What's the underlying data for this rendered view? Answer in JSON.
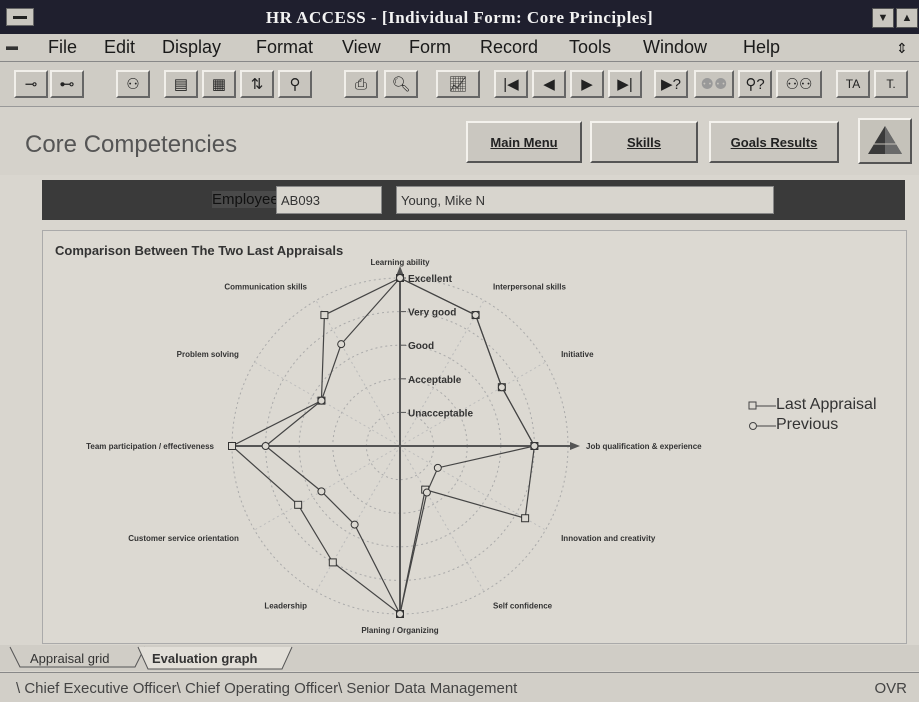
{
  "window": {
    "title": "HR ACCESS - [Individual Form: Core Principles]"
  },
  "menu": [
    "File",
    "Edit",
    "Display",
    "Format",
    "View",
    "Form",
    "Record",
    "Tools",
    "Window",
    "Help"
  ],
  "header": {
    "page_title": "Core Competencies",
    "buttons": {
      "main_menu": "Main Menu",
      "skills": "Skills",
      "goals_results": "Goals Results"
    }
  },
  "employee": {
    "label": "Employee:",
    "id": "AB093",
    "name": "Young, Mike N"
  },
  "panel": {
    "title": "Comparison Between The Two Last Appraisals"
  },
  "legend": {
    "last": "Last Appraisal",
    "previous": "Previous"
  },
  "tabs": {
    "appraisal_grid": "Appraisal grid",
    "evaluation_graph": "Evaluation graph"
  },
  "status": {
    "path": "\\ Chief Executive Officer\\ Chief Operating Officer\\ Senior Data Management",
    "mode": "OVR"
  },
  "chart_data": {
    "type": "radar",
    "title": "Comparison Between The Two Last Appraisals",
    "scale_labels": [
      "Unacceptable",
      "Acceptable",
      "Good",
      "Very good",
      "Excellent"
    ],
    "scale_range": [
      0,
      5
    ],
    "axes": [
      "Learning ability",
      "Interpersonal skills",
      "Initiative",
      "Job qualification & experience",
      "Innovation and creativity",
      "Self confidence",
      "Planing / Organizing",
      "Leadership",
      "Customer service orientation",
      "Team participation / effectiveness",
      "Problem solving",
      "Communication skills"
    ],
    "series": [
      {
        "name": "Last Appraisal",
        "values": [
          5,
          4.5,
          3.5,
          4,
          4.3,
          1.5,
          5,
          4,
          3.5,
          5,
          2.7,
          4.5
        ]
      },
      {
        "name": "Previous",
        "values": [
          5,
          4.5,
          3.5,
          4,
          1.3,
          1.6,
          5,
          2.7,
          2.7,
          4,
          2.7,
          3.5
        ]
      }
    ]
  }
}
